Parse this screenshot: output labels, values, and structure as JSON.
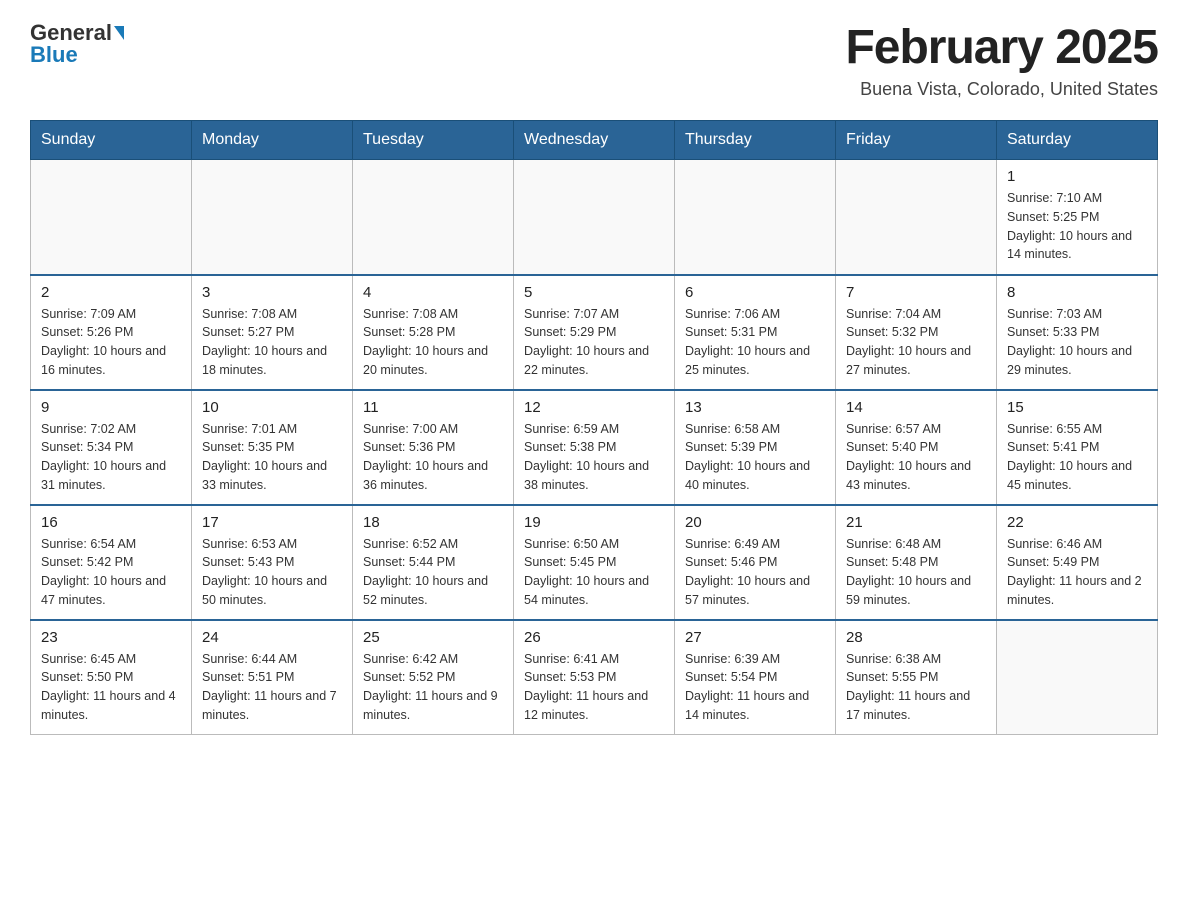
{
  "logo": {
    "general": "General",
    "blue": "Blue",
    "tagline": "GeneralBlue"
  },
  "header": {
    "month_title": "February 2025",
    "subtitle": "Buena Vista, Colorado, United States"
  },
  "days_of_week": [
    "Sunday",
    "Monday",
    "Tuesday",
    "Wednesday",
    "Thursday",
    "Friday",
    "Saturday"
  ],
  "weeks": [
    [
      {
        "day": "",
        "info": ""
      },
      {
        "day": "",
        "info": ""
      },
      {
        "day": "",
        "info": ""
      },
      {
        "day": "",
        "info": ""
      },
      {
        "day": "",
        "info": ""
      },
      {
        "day": "",
        "info": ""
      },
      {
        "day": "1",
        "info": "Sunrise: 7:10 AM\nSunset: 5:25 PM\nDaylight: 10 hours and 14 minutes."
      }
    ],
    [
      {
        "day": "2",
        "info": "Sunrise: 7:09 AM\nSunset: 5:26 PM\nDaylight: 10 hours and 16 minutes."
      },
      {
        "day": "3",
        "info": "Sunrise: 7:08 AM\nSunset: 5:27 PM\nDaylight: 10 hours and 18 minutes."
      },
      {
        "day": "4",
        "info": "Sunrise: 7:08 AM\nSunset: 5:28 PM\nDaylight: 10 hours and 20 minutes."
      },
      {
        "day": "5",
        "info": "Sunrise: 7:07 AM\nSunset: 5:29 PM\nDaylight: 10 hours and 22 minutes."
      },
      {
        "day": "6",
        "info": "Sunrise: 7:06 AM\nSunset: 5:31 PM\nDaylight: 10 hours and 25 minutes."
      },
      {
        "day": "7",
        "info": "Sunrise: 7:04 AM\nSunset: 5:32 PM\nDaylight: 10 hours and 27 minutes."
      },
      {
        "day": "8",
        "info": "Sunrise: 7:03 AM\nSunset: 5:33 PM\nDaylight: 10 hours and 29 minutes."
      }
    ],
    [
      {
        "day": "9",
        "info": "Sunrise: 7:02 AM\nSunset: 5:34 PM\nDaylight: 10 hours and 31 minutes."
      },
      {
        "day": "10",
        "info": "Sunrise: 7:01 AM\nSunset: 5:35 PM\nDaylight: 10 hours and 33 minutes."
      },
      {
        "day": "11",
        "info": "Sunrise: 7:00 AM\nSunset: 5:36 PM\nDaylight: 10 hours and 36 minutes."
      },
      {
        "day": "12",
        "info": "Sunrise: 6:59 AM\nSunset: 5:38 PM\nDaylight: 10 hours and 38 minutes."
      },
      {
        "day": "13",
        "info": "Sunrise: 6:58 AM\nSunset: 5:39 PM\nDaylight: 10 hours and 40 minutes."
      },
      {
        "day": "14",
        "info": "Sunrise: 6:57 AM\nSunset: 5:40 PM\nDaylight: 10 hours and 43 minutes."
      },
      {
        "day": "15",
        "info": "Sunrise: 6:55 AM\nSunset: 5:41 PM\nDaylight: 10 hours and 45 minutes."
      }
    ],
    [
      {
        "day": "16",
        "info": "Sunrise: 6:54 AM\nSunset: 5:42 PM\nDaylight: 10 hours and 47 minutes."
      },
      {
        "day": "17",
        "info": "Sunrise: 6:53 AM\nSunset: 5:43 PM\nDaylight: 10 hours and 50 minutes."
      },
      {
        "day": "18",
        "info": "Sunrise: 6:52 AM\nSunset: 5:44 PM\nDaylight: 10 hours and 52 minutes."
      },
      {
        "day": "19",
        "info": "Sunrise: 6:50 AM\nSunset: 5:45 PM\nDaylight: 10 hours and 54 minutes."
      },
      {
        "day": "20",
        "info": "Sunrise: 6:49 AM\nSunset: 5:46 PM\nDaylight: 10 hours and 57 minutes."
      },
      {
        "day": "21",
        "info": "Sunrise: 6:48 AM\nSunset: 5:48 PM\nDaylight: 10 hours and 59 minutes."
      },
      {
        "day": "22",
        "info": "Sunrise: 6:46 AM\nSunset: 5:49 PM\nDaylight: 11 hours and 2 minutes."
      }
    ],
    [
      {
        "day": "23",
        "info": "Sunrise: 6:45 AM\nSunset: 5:50 PM\nDaylight: 11 hours and 4 minutes."
      },
      {
        "day": "24",
        "info": "Sunrise: 6:44 AM\nSunset: 5:51 PM\nDaylight: 11 hours and 7 minutes."
      },
      {
        "day": "25",
        "info": "Sunrise: 6:42 AM\nSunset: 5:52 PM\nDaylight: 11 hours and 9 minutes."
      },
      {
        "day": "26",
        "info": "Sunrise: 6:41 AM\nSunset: 5:53 PM\nDaylight: 11 hours and 12 minutes."
      },
      {
        "day": "27",
        "info": "Sunrise: 6:39 AM\nSunset: 5:54 PM\nDaylight: 11 hours and 14 minutes."
      },
      {
        "day": "28",
        "info": "Sunrise: 6:38 AM\nSunset: 5:55 PM\nDaylight: 11 hours and 17 minutes."
      },
      {
        "day": "",
        "info": ""
      }
    ]
  ]
}
